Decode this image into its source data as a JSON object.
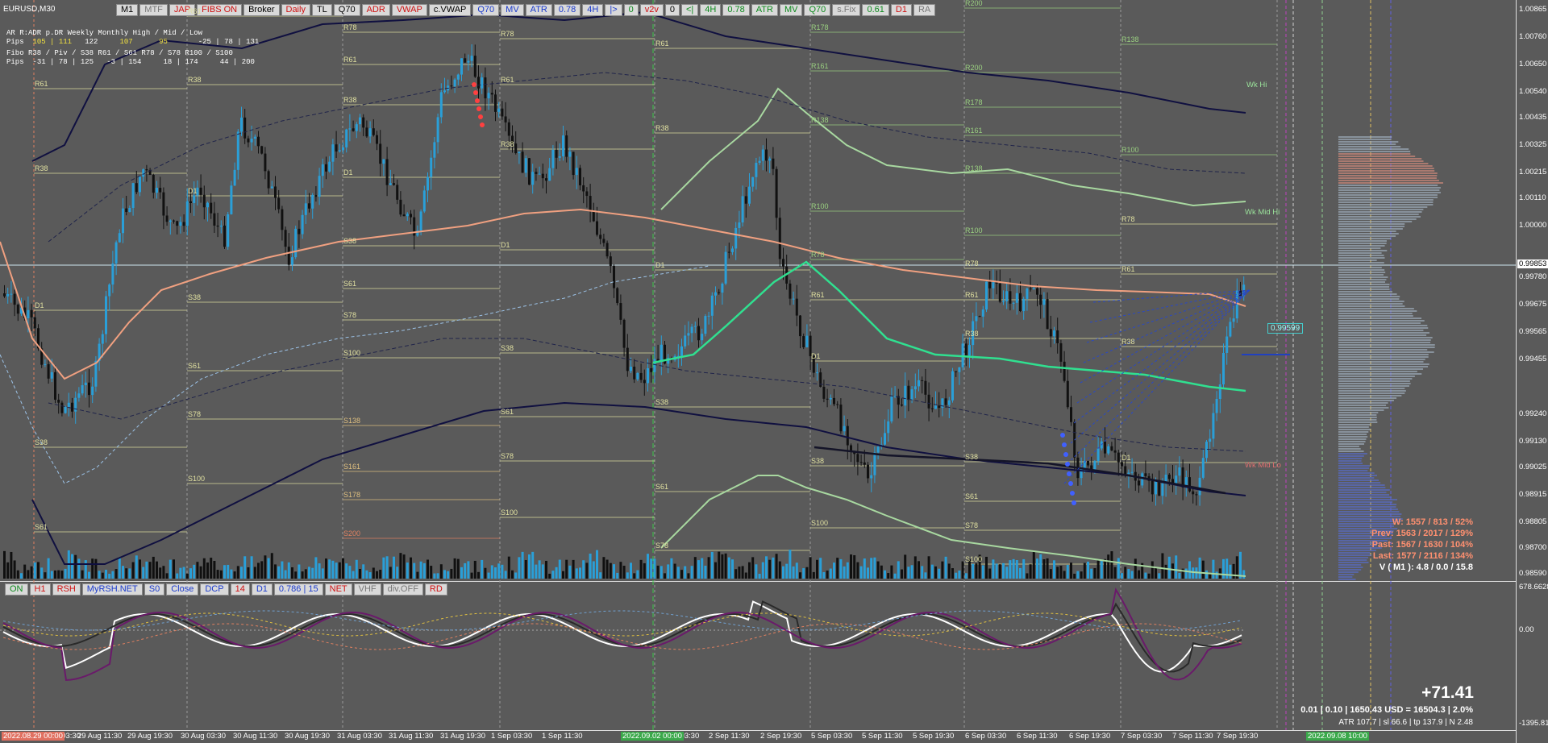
{
  "symbol": "EURUSD,M30",
  "top_toolbar": [
    {
      "label": "M1",
      "c": "black"
    },
    {
      "label": "MTF",
      "c": "gray"
    },
    {
      "label": "JAP",
      "c": "red"
    },
    {
      "label": "FIBS ON",
      "c": "red"
    },
    {
      "label": "Broker",
      "c": "black"
    },
    {
      "label": "Daily",
      "c": "red"
    },
    {
      "label": "TL",
      "c": "black"
    },
    {
      "label": "Q70",
      "c": "black"
    },
    {
      "label": "ADR",
      "c": "red"
    },
    {
      "label": "VWAP",
      "c": "red"
    },
    {
      "label": "c.VWAP",
      "c": "black"
    },
    {
      "label": "Q70",
      "c": "blue"
    },
    {
      "label": "MV",
      "c": "blue"
    },
    {
      "label": "ATR",
      "c": "blue"
    },
    {
      "label": "0.78",
      "c": "blue"
    },
    {
      "label": "4H",
      "c": "blue"
    },
    {
      "label": "|>",
      "c": "blue"
    },
    {
      "label": "0",
      "c": "green"
    },
    {
      "label": "v2v",
      "c": "red"
    },
    {
      "label": "0",
      "c": "black"
    },
    {
      "label": "<|",
      "c": "green"
    },
    {
      "label": "4H",
      "c": "green"
    },
    {
      "label": "0.78",
      "c": "green"
    },
    {
      "label": "ATR",
      "c": "green"
    },
    {
      "label": "MV",
      "c": "green"
    },
    {
      "label": "Q70",
      "c": "green"
    },
    {
      "label": "s.Fix",
      "c": "gray"
    },
    {
      "label": "0.61",
      "c": "green"
    },
    {
      "label": "D1",
      "c": "red"
    },
    {
      "label": "RA",
      "c": "gray"
    }
  ],
  "bottom_toolbar": [
    {
      "label": "ON",
      "c": "green"
    },
    {
      "label": "H1",
      "c": "red"
    },
    {
      "label": "RSH",
      "c": "red"
    },
    {
      "label": "MyRSH.NET",
      "c": "blue"
    },
    {
      "label": "S0",
      "c": "blue"
    },
    {
      "label": "Close",
      "c": "blue"
    },
    {
      "label": "DCP",
      "c": "blue"
    },
    {
      "label": "14",
      "c": "red"
    },
    {
      "label": "D1",
      "c": "blue"
    },
    {
      "label": "0.786 | 15",
      "c": "blue"
    },
    {
      "label": "NET",
      "c": "red"
    },
    {
      "label": "VHF",
      "c": "gray"
    },
    {
      "label": "div.OFF",
      "c": "gray"
    },
    {
      "label": "RD",
      "c": "red"
    }
  ],
  "stats": {
    "header": "AR   R:ADR     p.DR    Weekly    Monthly    High / Mid / Low",
    "pips_label": "Pips",
    "pips_values": [
      "105 | 111",
      "122",
      "107",
      "95",
      "-25 | 78 | 131"
    ],
    "fibo_header": "Fibo   R38 / Piv / S38     R61 / S61     R78 / S78     R100 / S100",
    "fibo_pips_label": "Pips",
    "fibo_values": [
      "-31 | 78 | 125",
      "-3 | 154",
      "18 | 174",
      "44 | 200"
    ]
  },
  "right_info": [
    {
      "text": "W: 1557 / 813 / 52%",
      "color": "#ff9070"
    },
    {
      "text": "Prev: 1563 / 2017 / 129%",
      "color": "#ff9070"
    },
    {
      "text": "Past: 1567 / 1630 / 104%",
      "color": "#ff9070"
    },
    {
      "text": "Last: 1577 / 2116 / 134%",
      "color": "#ff9070"
    },
    {
      "text": "V ( M1 ): 4.8 / 0.0 / 15.8",
      "color": "#ffffff"
    }
  ],
  "big_value": "+71.41",
  "bottom_info": "0.01  |  0.10  |  1650.43 USD = 16504.3  |  2.0%",
  "bottom_info2": "ATR 107.7  |  sl 66.6  |  tp 137.9  |  N 2.48",
  "price_axis": [
    "1.00865",
    "1.00760",
    "1.00650",
    "1.00540",
    "1.00435",
    "1.00325",
    "1.00215",
    "1.00110",
    "1.00000",
    "0.99853",
    "0.99780",
    "0.99675",
    "0.99565",
    "0.99455",
    "0.99240",
    "0.99130",
    "0.99025",
    "0.98915",
    "0.98805",
    "0.98700",
    "0.98590"
  ],
  "current_price": "0.99853",
  "indicator_axis": [
    "678.66283",
    "0.00",
    "-1395.81"
  ],
  "time_axis": [
    "29 Aug 03:30",
    "29 Aug 11:30",
    "29 Aug 19:30",
    "30 Aug 03:30",
    "30 Aug 11:30",
    "30 Aug 19:30",
    "31 Aug 03:30",
    "31 Aug 11:30",
    "31 Aug 19:30",
    "1 Sep 03:30",
    "1 Sep 11:30",
    "2 Sep 03:30",
    "2 Sep 11:30",
    "2 Sep 19:30",
    "5 Sep 03:30",
    "5 Sep 11:30",
    "5 Sep 19:30",
    "6 Sep 03:30",
    "6 Sep 11:30",
    "6 Sep 19:30",
    "7 Sep 03:30",
    "7 Sep 11:30",
    "7 Sep 19:30"
  ],
  "date_boxes": {
    "start": "2022.08.29 00:00",
    "mid": "2022.09.02 00:00",
    "end": "2022.09.08 10:00"
  },
  "level_labels": {
    "R61": "R61",
    "R78": "R78",
    "R38": "R38",
    "D1": "D1",
    "S38": "S38",
    "S61": "S61",
    "S78": "S78",
    "S100": "S100",
    "R100": "R100",
    "R138": "R138",
    "R161": "R161",
    "R178": "R178",
    "R200": "R200",
    "S138": "S138",
    "S161": "S161",
    "S178": "S178",
    "S200": "S200"
  },
  "wk_labels": {
    "hi": "Wk Hi",
    "mid_hi": "Wk Mid Hi",
    "mid_lo": "Wk Mid Lo"
  },
  "value_box": "0.99599",
  "colors": {
    "bg": "#5a5a5a",
    "bull": "#2a9fd8",
    "bear": "#111111",
    "vwap": "#f0a080",
    "ma_green": "#30e090",
    "navy": "#101040"
  }
}
